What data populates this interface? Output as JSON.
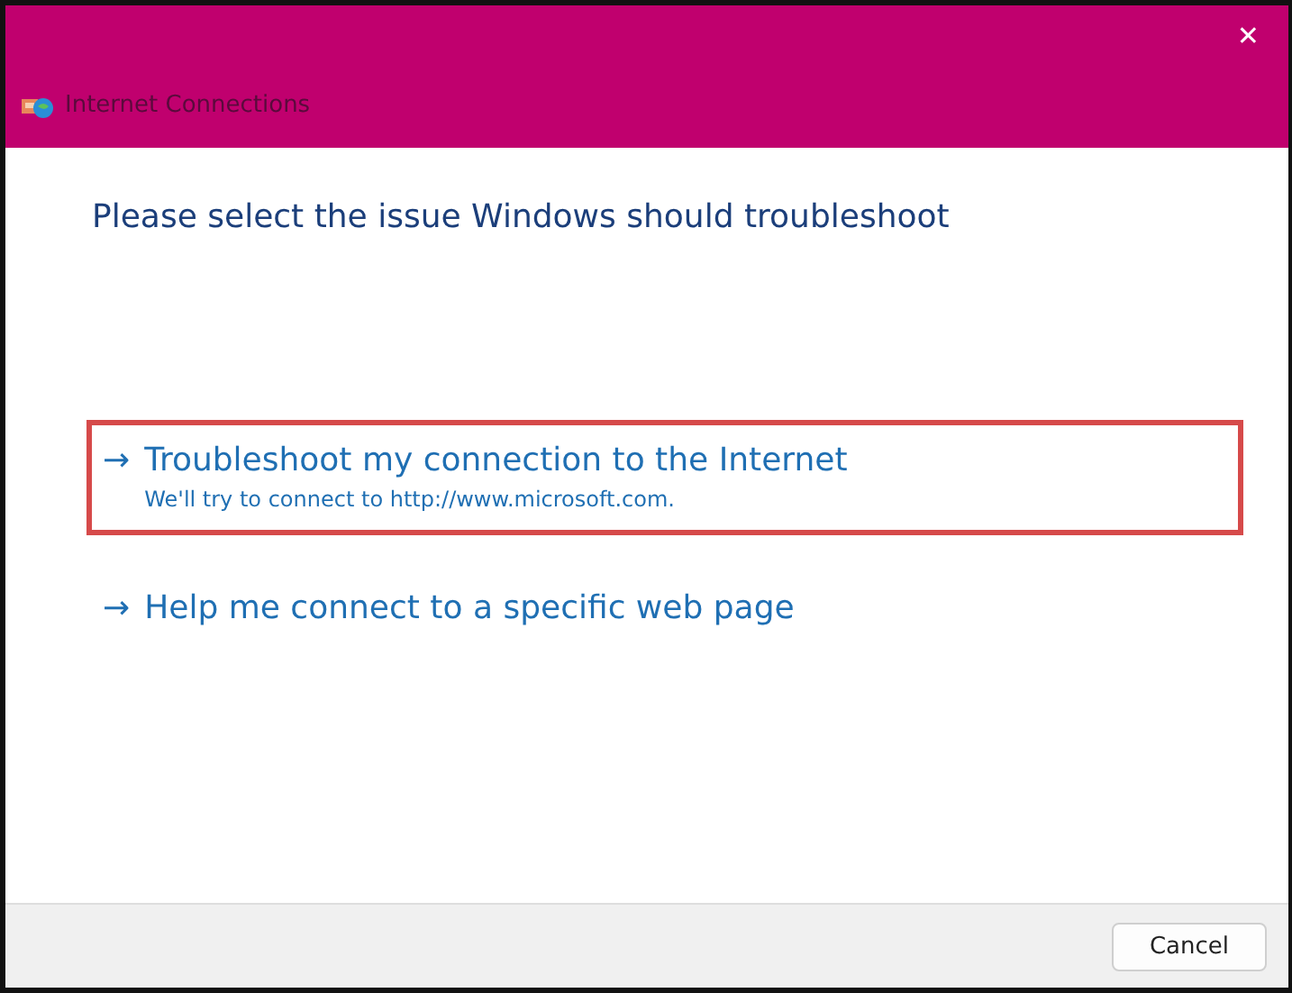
{
  "window": {
    "title": "Internet Connections",
    "close": "✕"
  },
  "heading": "Please select the issue Windows should troubleshoot",
  "options": [
    {
      "arrow": "→",
      "label": "Troubleshoot my connection to the Internet",
      "description": "We'll try to connect to http://www.microsoft.com.",
      "selected": true
    },
    {
      "arrow": "→",
      "label": "Help me connect to a specific web page",
      "selected": false
    }
  ],
  "buttons": [
    "Cancel"
  ]
}
